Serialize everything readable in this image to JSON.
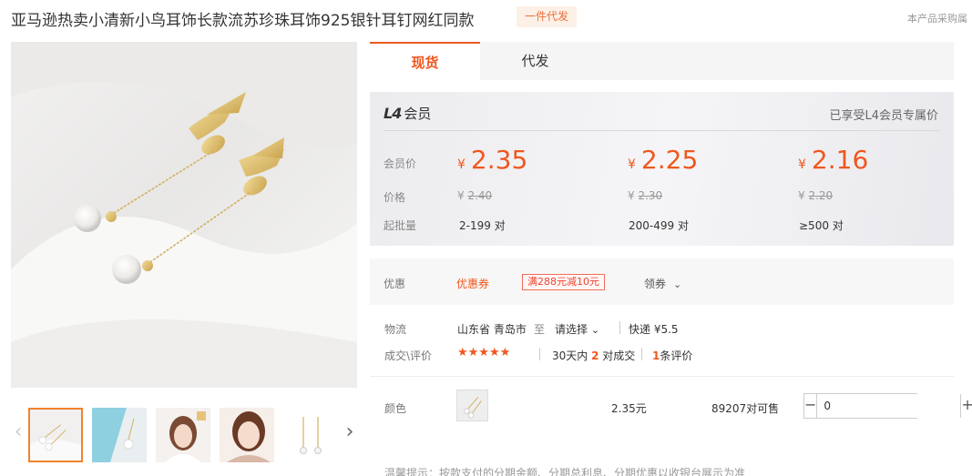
{
  "header": {
    "title": "亚马逊热卖小清新小鸟耳饰长款流苏珍珠耳饰925银针耳钉网红同款",
    "badge": "一件代发",
    "note": "本产品采购属"
  },
  "tabs": [
    {
      "label": "现货",
      "active": true
    },
    {
      "label": "代发",
      "active": false
    }
  ],
  "member": {
    "level": "L4",
    "level_label": "会员",
    "right_text": "已享受L4会员专属价",
    "labels": {
      "price": "会员价",
      "original": "价格",
      "moq": "起批量"
    },
    "currency": "¥",
    "tiers": [
      {
        "price": "2.35",
        "original": "2.40",
        "qty": "2-199 对"
      },
      {
        "price": "2.25",
        "original": "2.30",
        "qty": "200-499 对"
      },
      {
        "price": "2.16",
        "original": "2.20",
        "qty": "≥500 对"
      }
    ]
  },
  "promo": {
    "label": "优惠",
    "type": "优惠券",
    "coupon": "满288元减10元",
    "action": "领券"
  },
  "logistics": {
    "label": "物流",
    "from": "山东省 青岛市",
    "to_word": "至",
    "destination": "请选择",
    "shipping": "快递 ¥5.5"
  },
  "reviews": {
    "label": "成交\\评价",
    "stars": "★★★★★",
    "rating": 5,
    "sales_prefix": "30天内",
    "sales_count": "2",
    "sales_suffix": "对成交",
    "review_count": "1",
    "review_suffix": "条评价"
  },
  "sku": {
    "label": "颜色",
    "price": "2.35元",
    "stock": "89207对可售",
    "quantity": "0"
  },
  "tip": "温馨提示：按款支付的分期金额、分期总利息、分期优惠以收银台展示为准",
  "colors": {
    "accent": "#f0571e",
    "badge_bg": "#fdf0e6",
    "thumb_border": "#f0832d"
  }
}
